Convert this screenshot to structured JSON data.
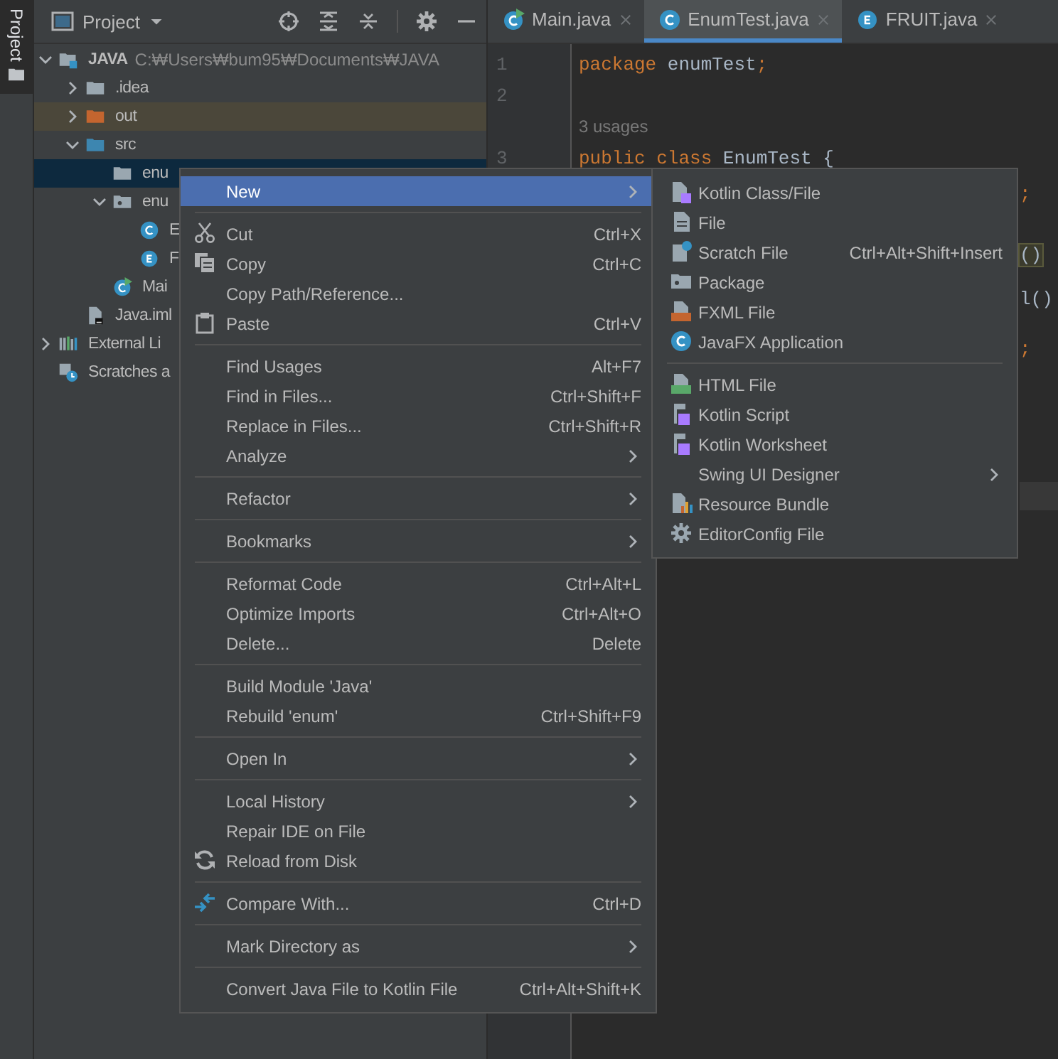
{
  "tool_stripe": {
    "label": "Project"
  },
  "project_panel": {
    "title": "Project"
  },
  "tree": [
    {
      "label": "JAVA",
      "detail": "C:₩Users₩bum95₩Documents₩JAVA",
      "kind": "module",
      "expanded": true,
      "selected": false,
      "children": [
        {
          "label": ".idea",
          "kind": "folder",
          "expanded": false,
          "selected": false
        },
        {
          "label": "out",
          "kind": "excluded",
          "expanded": false,
          "selected": false
        },
        {
          "label": "src",
          "kind": "source",
          "expanded": true,
          "selected": false,
          "children": [
            {
              "label": "enu",
              "kind": "folder",
              "selected": true
            },
            {
              "label": "enu",
              "kind": "package",
              "expanded": true,
              "selected": false,
              "children": [
                {
                  "label": "E",
                  "kind": "class",
                  "selected": false
                },
                {
                  "label": "F",
                  "kind": "enum",
                  "selected": false
                }
              ]
            },
            {
              "label": "Mai",
              "kind": "main",
              "selected": false
            }
          ]
        },
        {
          "label": "Java.iml",
          "kind": "file",
          "selected": false
        }
      ]
    },
    {
      "label": "External Li",
      "kind": "libraries",
      "expanded": false,
      "selected": false
    },
    {
      "label": "Scratches a",
      "kind": "scratches",
      "selected": false
    }
  ],
  "tabs": [
    {
      "label": "Main.java",
      "kind": "main",
      "selected": false
    },
    {
      "label": "EnumTest.java",
      "kind": "class",
      "selected": true
    },
    {
      "label": "FRUIT.java",
      "kind": "enum",
      "selected": false
    }
  ],
  "editor": {
    "lines": [
      {
        "number": "1",
        "tokens": [
          {
            "text": "package",
            "kind": "keyword"
          },
          {
            "text": " enumTest",
            "kind": "plain"
          },
          {
            "text": ";",
            "kind": "keyword"
          }
        ]
      },
      {
        "number": "2"
      },
      {
        "hint": "3 usages"
      },
      {
        "number": "3",
        "tokens": [
          {
            "text": "public class",
            "kind": "keyword"
          },
          {
            "text": " EnumTest {",
            "kind": "plain"
          }
        ]
      }
    ],
    "fragments": [
      {
        "text": ";",
        "kind": "keyword"
      },
      {
        "text": "()",
        "kind": "plain"
      },
      {
        "text": "l()",
        "kind": "plain"
      },
      {
        "text": ";",
        "kind": "keyword"
      }
    ]
  },
  "context_menu": [
    {
      "kind": "item",
      "label": "New",
      "submenu": true,
      "selected": true
    },
    {
      "kind": "separator"
    },
    {
      "kind": "item",
      "label": "Cut",
      "shortcut": "Ctrl+X",
      "selected": false
    },
    {
      "kind": "item",
      "label": "Copy",
      "shortcut": "Ctrl+C",
      "selected": false
    },
    {
      "kind": "item",
      "label": "Copy Path/Reference...",
      "selected": false
    },
    {
      "kind": "item",
      "label": "Paste",
      "shortcut": "Ctrl+V",
      "selected": false
    },
    {
      "kind": "separator"
    },
    {
      "kind": "item",
      "label": "Find Usages",
      "shortcut": "Alt+F7",
      "selected": false
    },
    {
      "kind": "item",
      "label": "Find in Files...",
      "shortcut": "Ctrl+Shift+F",
      "selected": false
    },
    {
      "kind": "item",
      "label": "Replace in Files...",
      "shortcut": "Ctrl+Shift+R",
      "selected": false
    },
    {
      "kind": "item",
      "label": "Analyze",
      "submenu": true,
      "selected": false
    },
    {
      "kind": "separator"
    },
    {
      "kind": "item",
      "label": "Refactor",
      "submenu": true,
      "selected": false
    },
    {
      "kind": "separator"
    },
    {
      "kind": "item",
      "label": "Bookmarks",
      "submenu": true,
      "selected": false
    },
    {
      "kind": "separator"
    },
    {
      "kind": "item",
      "label": "Reformat Code",
      "shortcut": "Ctrl+Alt+L",
      "selected": false
    },
    {
      "kind": "item",
      "label": "Optimize Imports",
      "shortcut": "Ctrl+Alt+O",
      "selected": false
    },
    {
      "kind": "item",
      "label": "Delete...",
      "shortcut": "Delete",
      "selected": false
    },
    {
      "kind": "separator"
    },
    {
      "kind": "item",
      "label": "Build Module 'Java'",
      "selected": false
    },
    {
      "kind": "item",
      "label": "Rebuild 'enum'",
      "shortcut": "Ctrl+Shift+F9",
      "selected": false
    },
    {
      "kind": "separator"
    },
    {
      "kind": "item",
      "label": "Open In",
      "submenu": true,
      "selected": false
    },
    {
      "kind": "separator"
    },
    {
      "kind": "item",
      "label": "Local History",
      "submenu": true,
      "selected": false
    },
    {
      "kind": "item",
      "label": "Repair IDE on File",
      "selected": false
    },
    {
      "kind": "item",
      "label": "Reload from Disk",
      "selected": false
    },
    {
      "kind": "separator"
    },
    {
      "kind": "item",
      "label": "Compare With...",
      "shortcut": "Ctrl+D",
      "selected": false
    },
    {
      "kind": "separator"
    },
    {
      "kind": "item",
      "label": "Mark Directory as",
      "submenu": true,
      "selected": false
    },
    {
      "kind": "separator"
    },
    {
      "kind": "item",
      "label": "Convert Java File to Kotlin File",
      "shortcut": "Ctrl+Alt+Shift+K",
      "selected": false
    }
  ],
  "new_submenu": [
    {
      "kind": "item",
      "label": "Kotlin Class/File",
      "selected": false
    },
    {
      "kind": "item",
      "label": "File",
      "selected": false
    },
    {
      "kind": "item",
      "label": "Scratch File",
      "shortcut": "Ctrl+Alt+Shift+Insert",
      "selected": false
    },
    {
      "kind": "item",
      "label": "Package",
      "selected": false
    },
    {
      "kind": "item",
      "label": "FXML File",
      "selected": false
    },
    {
      "kind": "item",
      "label": "JavaFX Application",
      "selected": false
    },
    {
      "kind": "separator"
    },
    {
      "kind": "item",
      "label": "HTML File",
      "selected": false
    },
    {
      "kind": "item",
      "label": "Kotlin Script",
      "selected": false
    },
    {
      "kind": "item",
      "label": "Kotlin Worksheet",
      "selected": false
    },
    {
      "kind": "item",
      "label": "Swing UI Designer",
      "submenu": true,
      "selected": false
    },
    {
      "kind": "item",
      "label": "Resource Bundle",
      "selected": false
    },
    {
      "kind": "item",
      "label": "EditorConfig File",
      "selected": false
    }
  ]
}
